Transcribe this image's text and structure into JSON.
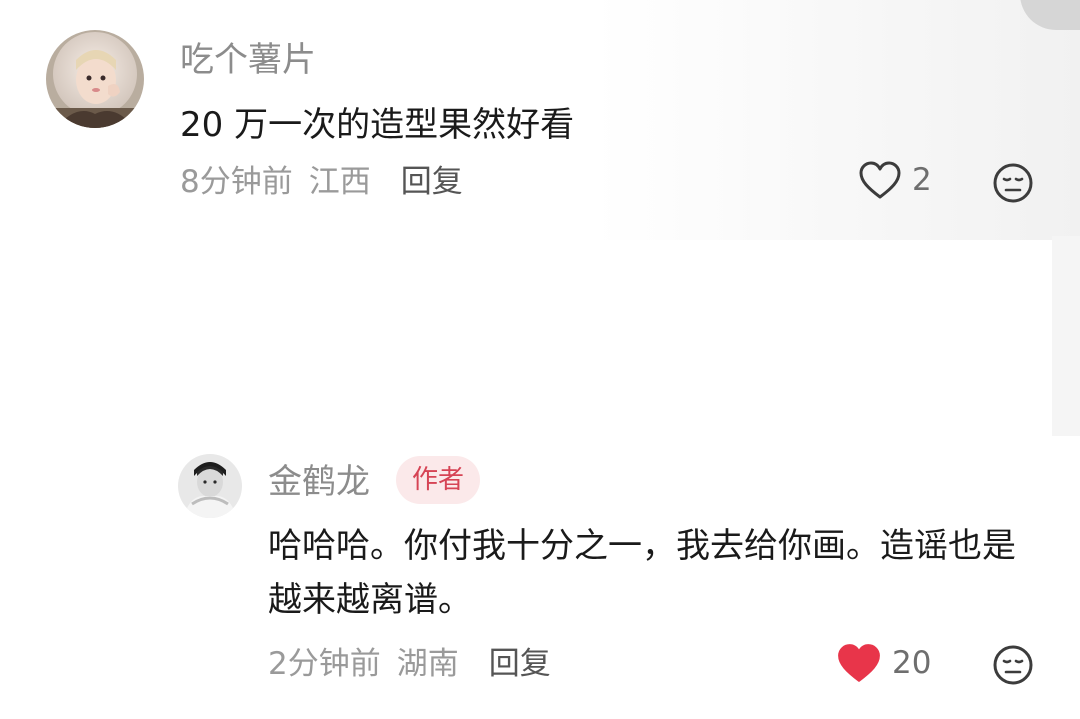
{
  "comments": [
    {
      "username": "吃个薯片",
      "text": "20 万一次的造型果然好看",
      "time": "8分钟前",
      "location": "江西",
      "reply_label": "回复",
      "likes": "2",
      "liked": false,
      "avatar_icon": "avatar-girl-fur-hood"
    },
    {
      "username": "金鹤龙",
      "author_tag": "作者",
      "text": "哈哈哈。你付我十分之一，我去给你画。造谣也是越来越离谱。",
      "time": "2分钟前",
      "location": "湖南",
      "reply_label": "回复",
      "likes": "20",
      "liked": true,
      "avatar_icon": "avatar-man-bw-photo"
    }
  ],
  "colors": {
    "liked_heart": "#e8354a",
    "author_tag_bg": "#fbe9ea",
    "author_tag_text": "#d64455",
    "username": "#8c8c8c",
    "meta": "#9a9a9a"
  }
}
